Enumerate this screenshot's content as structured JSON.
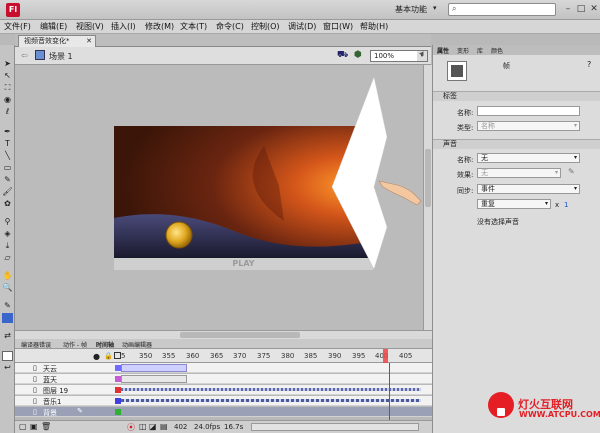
{
  "app": {
    "logo_text": "Fl",
    "workspace": "基本功能"
  },
  "search": {
    "placeholder": ""
  },
  "menu": [
    "文件(F)",
    "编辑(E)",
    "视图(V)",
    "插入(I)",
    "修改(M)",
    "文本(T)",
    "命令(C)",
    "控制(O)",
    "调试(D)",
    "窗口(W)",
    "帮助(H)"
  ],
  "document": {
    "tab_title": "视频音效变化*",
    "scene": "场景 1",
    "zoom": "100%"
  },
  "stage": {
    "play_label": "PLAY"
  },
  "timeline": {
    "tabs": [
      "编译器错误",
      "动作 - 帧",
      "时间轴",
      "动画编辑器"
    ],
    "ruler": [
      "5",
      "350",
      "355",
      "360",
      "365",
      "370",
      "375",
      "380",
      "385",
      "390",
      "395",
      "400",
      "405"
    ],
    "layers": [
      {
        "name": "天云",
        "color": "#6b6bff"
      },
      {
        "name": "蓝天",
        "color": "#c65bd6"
      },
      {
        "name": "图层 19",
        "color": "#e03030"
      },
      {
        "name": "音乐1",
        "color": "#4040e0"
      },
      {
        "name": "背景",
        "color": "#30b030"
      }
    ],
    "footer": {
      "frame": "402",
      "fps": "24.0fps",
      "time": "16.7s"
    }
  },
  "properties": {
    "tabs": [
      "属性",
      "变形",
      "库",
      "颜色"
    ],
    "frame_title": "帧",
    "label_section": "标签",
    "name_label": "名称:",
    "type_label": "类型:",
    "type_value": "名称",
    "sound_section": "声音",
    "sound_name_label": "名称:",
    "sound_name_value": "无",
    "effect_label": "效果:",
    "effect_value": "无",
    "sync_label": "同步:",
    "sync_value": "事件",
    "repeat_value": "重复",
    "repeat_x": "x",
    "repeat_count": "1",
    "no_sound": "没有选择声音"
  },
  "watermark": {
    "cn": "灯火互联网",
    "url": "WWW.ATCPU.COM"
  }
}
